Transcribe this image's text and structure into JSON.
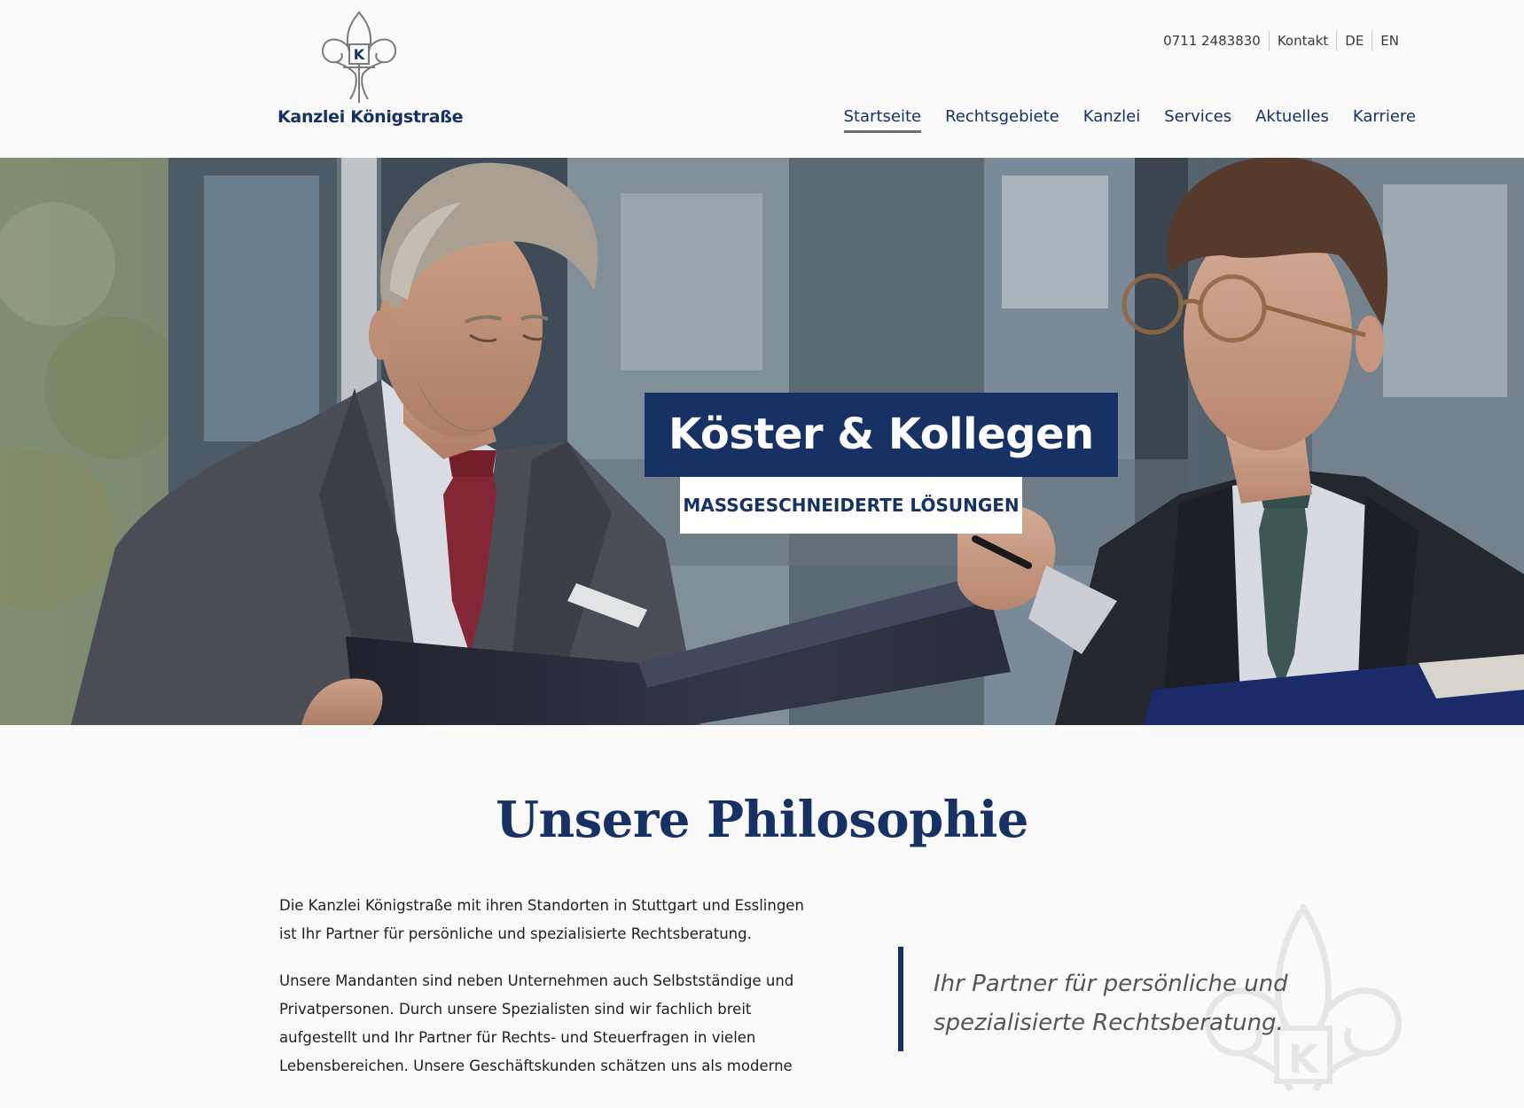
{
  "header": {
    "logo_text": "Kanzlei Königstraße",
    "logo_letter": "K",
    "utility": {
      "phone": "0711 2483830",
      "contact": "Kontakt",
      "lang_de": "DE",
      "lang_en": "EN"
    },
    "nav": {
      "item1": "Startseite",
      "item2": "Rechtsgebiete",
      "item3": "Kanzlei",
      "item4": "Services",
      "item5": "Aktuelles",
      "item6": "Karriere"
    }
  },
  "hero": {
    "title": "Köster & Kollegen",
    "subtitle": "MASSGESCHNEIDERTE LÖSUNGEN"
  },
  "philosophy": {
    "title": "Unsere Philosophie",
    "paragraph1": "Die Kanzlei Königstraße mit ihren Standorten in Stuttgart und Esslingen ist Ihr Partner für persönliche und spezialisierte Rechtsberatung.",
    "paragraph2": "Unsere Mandanten sind neben Unternehmen auch Selbstständige und Privatpersonen. Durch unsere Spezialisten sind wir fachlich breit aufgestellt und Ihr Partner für Rechts- und Steuerfragen in vielen Lebensbereichen. Unsere Geschäftskunden schätzen uns als moderne",
    "quote": "Ihr Partner für persönliche und spezialisierte Rechtsberatung."
  },
  "colors": {
    "brand_navy": "#173165",
    "background": "#fafafa"
  },
  "icons": {
    "logo": "fleur-de-lis-icon",
    "watermark": "fleur-de-lis-icon"
  }
}
